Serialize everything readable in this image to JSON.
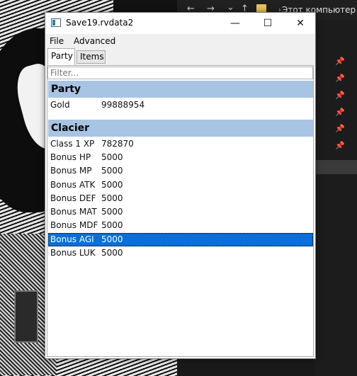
{
  "explorer": {
    "back": "←",
    "forward": "→",
    "dropdown": "⌄",
    "up": "↑",
    "separator": "›",
    "location": "Этот компьютер",
    "pin_icon": "pin-icon"
  },
  "window": {
    "title": "Save19.rvdata2",
    "controls": {
      "minimize": "—",
      "maximize": "☐",
      "close": "✕"
    }
  },
  "menu": {
    "file": "File",
    "advanced": "Advanced"
  },
  "tabs": [
    {
      "label": "Party",
      "active": true
    },
    {
      "label": "Items",
      "active": false
    }
  ],
  "filter": {
    "placeholder": "Filter...",
    "value": ""
  },
  "sections": [
    {
      "header": "Party",
      "rows": [
        {
          "key": "Gold",
          "value": "99888954"
        }
      ]
    },
    {
      "header": "Clacier",
      "rows": [
        {
          "key": "Class 1 XP",
          "value": "782870"
        },
        {
          "key": "Bonus HP",
          "value": "5000"
        },
        {
          "key": "Bonus MP",
          "value": "5000"
        },
        {
          "key": "Bonus ATK",
          "value": "5000"
        },
        {
          "key": "Bonus DEF",
          "value": "5000"
        },
        {
          "key": "Bonus MAT",
          "value": "5000"
        },
        {
          "key": "Bonus MDF",
          "value": "5000"
        },
        {
          "key": "Bonus AGI",
          "value": "5000",
          "selected": true
        },
        {
          "key": "Bonus LUK",
          "value": "5000"
        }
      ]
    }
  ],
  "colors": {
    "section_header": "#a8c4e4",
    "selection": "#0a6fd6"
  }
}
